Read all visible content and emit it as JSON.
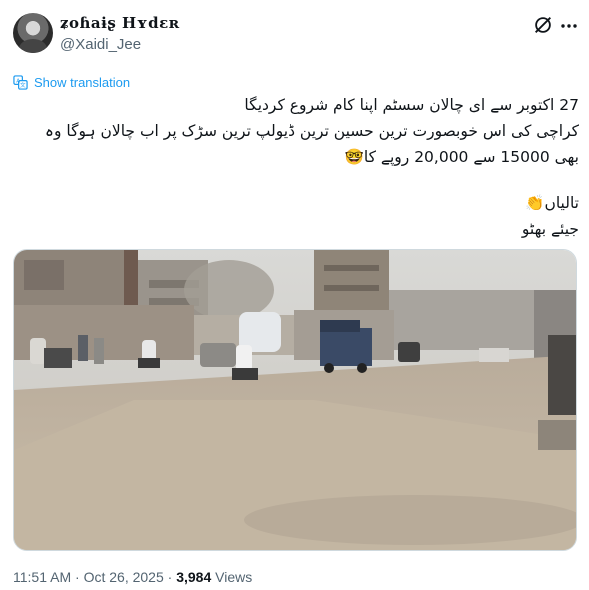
{
  "user": {
    "display_name": "ʑoɦaɨʂ Hʏdɛʀ",
    "handle": "@Xaidi_Jee"
  },
  "icons": {
    "avatar": "user-avatar",
    "grok": "grok-icon",
    "more": "more-icon",
    "translate": "translate-icon"
  },
  "colors": {
    "link": "#1d9bf0",
    "secondary": "#536471",
    "text": "#0f1419"
  },
  "translation": {
    "label": "Show translation"
  },
  "tweet": {
    "lines": [
      "27 اکتوبر سے ای چالان سسٹم اپنا کام شروع کردیگا",
      "کراچی کی اس خوبصورت ترین حسین ترین ڈیولپ ترین سڑک پر اب چالان ہوگا وہ",
      "بھی 15000 سے 20,000 روپے کا🤓"
    ],
    "lines2": [
      "تالیاں👏",
      "جیئے بھٹو"
    ]
  },
  "media": {
    "description_alt": ""
  },
  "meta": {
    "time": "11:51 AM",
    "separator": " · ",
    "date": "Oct 26, 2025",
    "views_count": "3,984",
    "views_label": " Views"
  }
}
